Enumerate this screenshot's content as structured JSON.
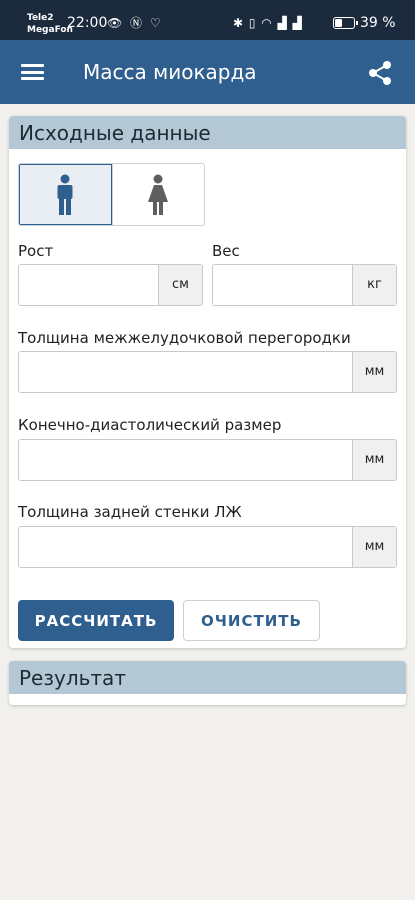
{
  "status_bar": {
    "carrier_1": "Tele2",
    "carrier_2": "MegaFon",
    "time": "22:00",
    "left_icons": "👁 Ⓝ ♡",
    "right_icons": "✱ ▯ ◠ ▟ ▟",
    "battery_percent": 39,
    "battery_text": "39 %"
  },
  "app_bar": {
    "title": "Масса миокарда",
    "menu_icon": "menu-icon",
    "share_icon": "share-icon"
  },
  "input_section": {
    "title": "Исходные данные",
    "gender": {
      "options": [
        "male",
        "female"
      ],
      "selected": "male"
    },
    "height": {
      "label": "Рост",
      "value": "",
      "unit": "см"
    },
    "weight": {
      "label": "Вес",
      "value": "",
      "unit": "кг"
    },
    "ivs": {
      "label": "Толщина межжелудочковой перегородки",
      "value": "",
      "unit": "мм"
    },
    "edd": {
      "label": "Конечно-диастолический размер",
      "value": "",
      "unit": "мм"
    },
    "pw": {
      "label": "Толщина задней стенки ЛЖ",
      "value": "",
      "unit": "мм"
    },
    "calculate_label": "РАССЧИТАТЬ",
    "clear_label": "ОЧИСТИТЬ"
  },
  "result_section": {
    "title": "Результат"
  },
  "colors": {
    "status_bar": "#1b2a3c",
    "app_bar": "#2f5f8e",
    "section_header": "#b3c7d5",
    "background": "#f1f0ed"
  }
}
